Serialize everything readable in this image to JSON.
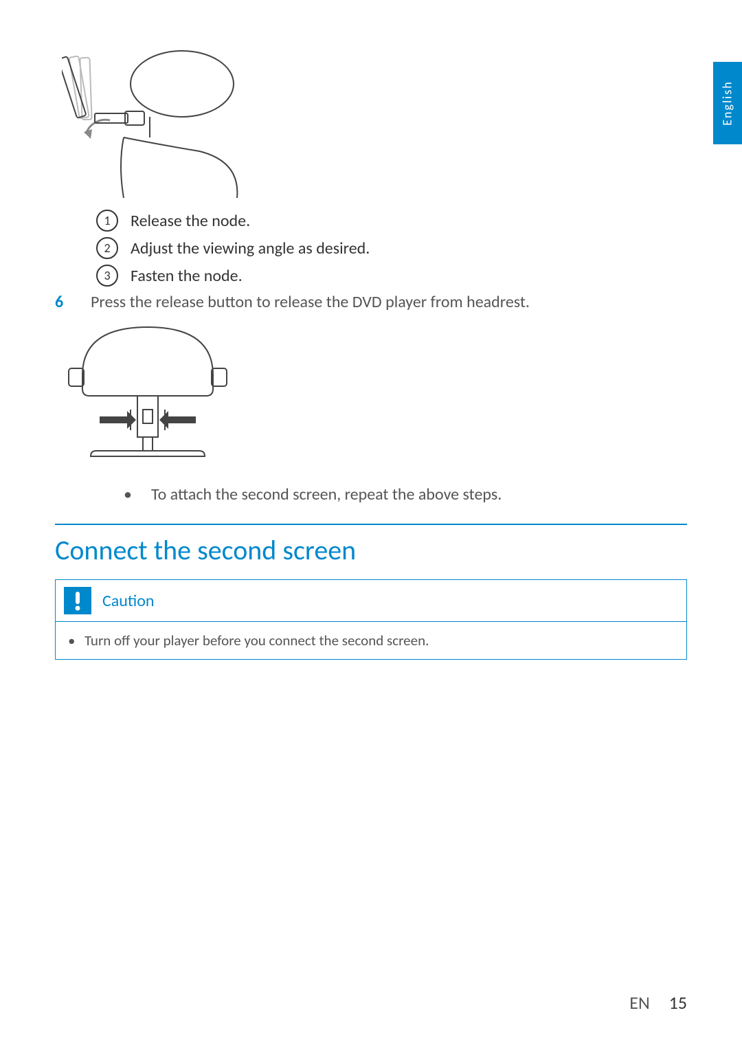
{
  "language_tab": "English",
  "sub_steps": [
    {
      "num": "1",
      "text": "Release the node."
    },
    {
      "num": "2",
      "text": "Adjust the viewing angle as desired."
    },
    {
      "num": "3",
      "text": "Fasten the node."
    }
  ],
  "main_step": {
    "num": "6",
    "text": "Press the release button to release the DVD player from headrest."
  },
  "bullet_note": "To attach the second screen, repeat the above steps.",
  "section_heading": "Connect the second screen",
  "caution": {
    "title": "Caution",
    "text": "Turn off your player before you connect the second screen."
  },
  "footer": {
    "lang": "EN",
    "page": "15"
  }
}
